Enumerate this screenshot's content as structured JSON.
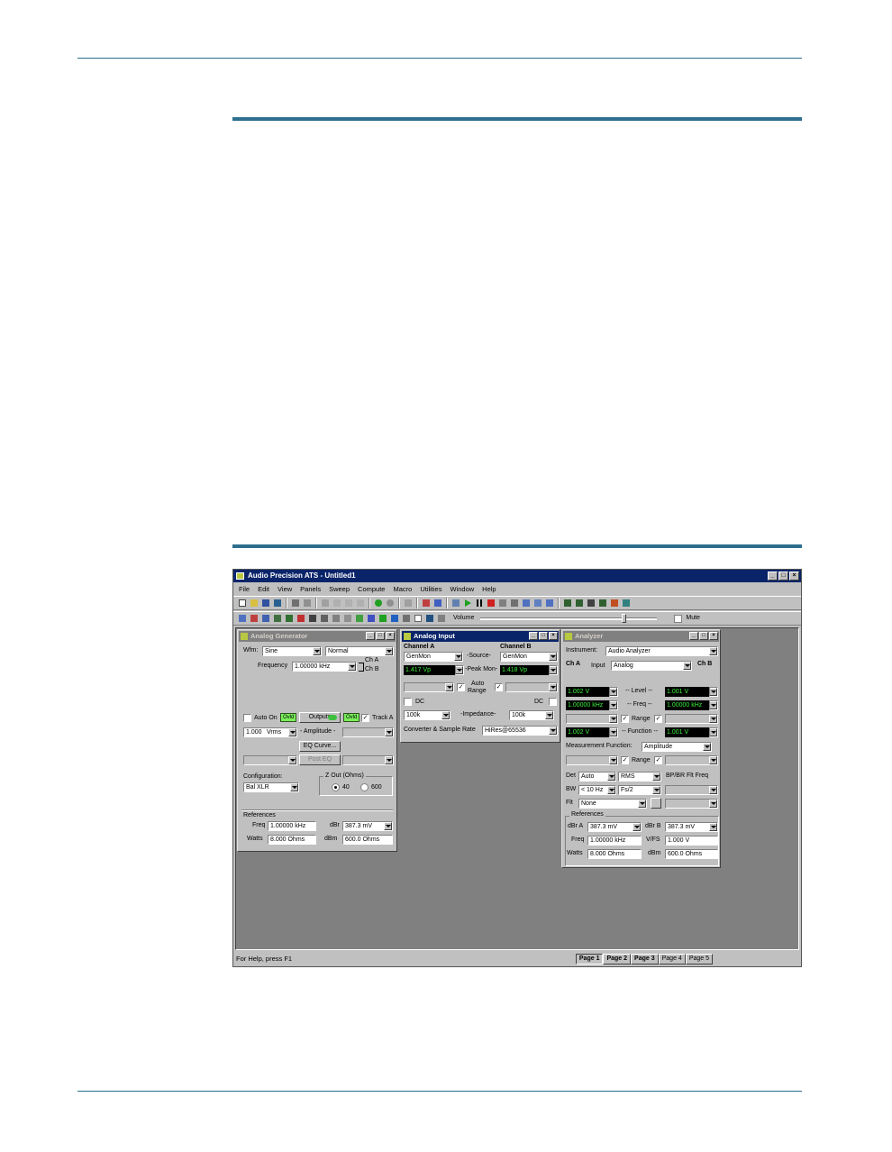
{
  "app": {
    "title": "Audio Precision ATS - Untitled1",
    "win_min": "_",
    "win_max": "□",
    "win_close": "×"
  },
  "menu": [
    "File",
    "Edit",
    "View",
    "Panels",
    "Sweep",
    "Compute",
    "Macro",
    "Utilities",
    "Window",
    "Help"
  ],
  "toolbar": {
    "volume_label": "Volume",
    "volume_level": 0.82,
    "mute_label": "Mute"
  },
  "generator": {
    "title": "Analog Generator",
    "wfm_label": "Wfm:",
    "wfm_value": "Sine",
    "wfm_mode": "Normal",
    "frequency_label": "Frequency",
    "frequency_value": "1.00000 kHz",
    "ch_a": "Ch A",
    "ch_b": "Ch B",
    "auto_on": "Auto On",
    "led_on_1": "Ovld",
    "outputs": "Outputs",
    "led_on_2": "Ovld",
    "track_a": "Track A",
    "amplitude_value": "1.000",
    "amplitude_unit": "Vrms",
    "amplitude_label": "- Amplitude -",
    "eq_curve": "EQ Curve...",
    "post_eq": "Post EQ",
    "configuration_label": "Configuration:",
    "configuration_value": "Bal XLR",
    "zout_label": "Z Out (Ohms)",
    "zout_40": "40",
    "zout_600": "600",
    "references_label": "References",
    "ref_freq_label": "Freq",
    "ref_freq_value": "1.00000 kHz",
    "ref_dbr_label": "dBr",
    "ref_dbr_value": "387.3",
    "ref_dbr_unit": "mV",
    "ref_watts_label": "Watts",
    "ref_watts_value": "8.000",
    "ref_watts_unit": "Ohms",
    "ref_dbm_label": "dBm",
    "ref_dbm_value": "600.0",
    "ref_dbm_unit": "Ohms"
  },
  "analog_input": {
    "title": "Analog Input",
    "channel_a": "Channel A",
    "source_label": "-Source-",
    "channel_b": "Channel B",
    "source_a": "GenMon",
    "source_b": "GenMon",
    "peak_a": "1.417 Vp",
    "peak_label": "-Peak Mon-",
    "peak_b": "1.418 Vp",
    "auto_range": "Auto",
    "auto_range_2": "Range",
    "dc_label": "DC",
    "dc_label_b": "DC",
    "impedance_a": "100k",
    "impedance_label": "-Impedance-",
    "impedance_b": "100k",
    "converter_label": "Converter & Sample Rate",
    "converter_value": "HiRes@65536"
  },
  "analyzer": {
    "title": "Analyzer",
    "instrument_label": "Instrument:",
    "instrument_value": "Audio Analyzer",
    "ch_a": "Ch A",
    "input_label": "Input",
    "input_value": "Analog",
    "ch_b": "Ch B",
    "level_a": "1.002 V",
    "level_label": "-- Level --",
    "level_b": "1.001 V",
    "freq_a": "1.00000 kHz",
    "freq_label": "-- Freq --",
    "freq_b": "1.00000 kHz",
    "range_label": "Range",
    "func_a": "1.002 V",
    "func_label": "-- Function --",
    "func_b": "1.001 V",
    "meas_func_label": "Measurement Function:",
    "meas_func_value": "Amplitude",
    "range_label_2": "Range",
    "det_label": "Det",
    "det_value": "Auto",
    "det_mode": "RMS",
    "bp_label": "BP/BR Flt Freq",
    "bw_label": "BW",
    "bw_value": "< 10 Hz",
    "bw_high": "Fs/2",
    "flt_label": "Flt",
    "flt_value": "None",
    "references_label": "References",
    "dbra_label": "dBr A",
    "dbra_value": "387.3",
    "dbra_unit": "mV",
    "dbrb_label": "dBr B",
    "dbrb_value": "387.3",
    "dbrb_unit": "mV",
    "freq_ref_label": "Freq",
    "freq_ref_value": "1.00000 kHz",
    "vfs_label": "V/FS",
    "vfs_value": "1.000",
    "vfs_unit": "V",
    "watts_label": "Watts",
    "watts_value": "8.000",
    "watts_unit": "Ohms",
    "dbm_label": "dBm",
    "dbm_value": "600.0",
    "dbm_unit": "Ohms"
  },
  "status": {
    "help": "For Help, press F1",
    "pages": [
      "Page 1",
      "Page 2",
      "Page 3",
      "Page 4",
      "Page 5"
    ]
  }
}
